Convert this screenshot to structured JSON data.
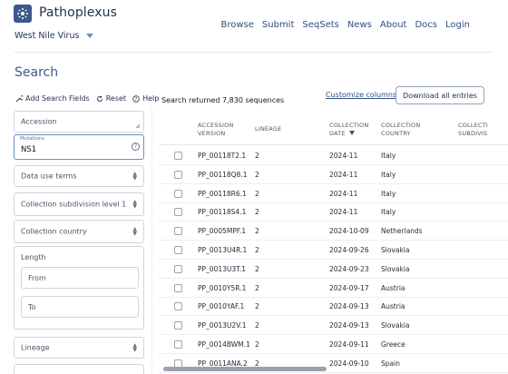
{
  "header": {
    "brand": "Pathoplexus",
    "organism": "West Nile Virus",
    "nav": [
      "Browse",
      "Submit",
      "SeqSets",
      "News",
      "About",
      "Docs",
      "Login"
    ]
  },
  "page": {
    "title": "Search"
  },
  "sidebar": {
    "tools": {
      "add_fields": "Add Search Fields",
      "reset": "Reset",
      "help": "Help"
    },
    "accession_label": "Accession",
    "mutations_label": "Mutations",
    "mutations_value": "NS1",
    "data_use_label": "Data use terms",
    "subdivision_label": "Collection subdivision level 1",
    "country_label": "Collection country",
    "length_label": "Length",
    "length_from": "From",
    "length_to": "To",
    "lineage_label": "Lineage"
  },
  "results": {
    "count_text": "Search returned 7,830 sequences",
    "customize_columns": "Customize columns",
    "download_all": "Download all entries",
    "columns": {
      "accession_l1": "ACCESSION",
      "accession_l2": "VERSION",
      "lineage": "LINEAGE",
      "date_l1": "COLLECTION",
      "date_l2": "DATE",
      "country_l1": "COLLECTION",
      "country_l2": "COUNTRY",
      "subdiv_l1": "COLLECTI",
      "subdiv_l2": "SUBDIVIS"
    },
    "rows": [
      {
        "accession": "PP_00118T2.1",
        "lineage": "2",
        "date": "2024-11",
        "country": "Italy"
      },
      {
        "accession": "PP_00118Q8.1",
        "lineage": "2",
        "date": "2024-11",
        "country": "Italy"
      },
      {
        "accession": "PP_00118R6.1",
        "lineage": "2",
        "date": "2024-11",
        "country": "Italy"
      },
      {
        "accession": "PP_00118S4.1",
        "lineage": "2",
        "date": "2024-11",
        "country": "Italy"
      },
      {
        "accession": "PP_0005MPF.1",
        "lineage": "2",
        "date": "2024-10-09",
        "country": "Netherlands"
      },
      {
        "accession": "PP_0013U4R.1",
        "lineage": "2",
        "date": "2024-09-26",
        "country": "Slovakia"
      },
      {
        "accession": "PP_0013U3T.1",
        "lineage": "2",
        "date": "2024-09-23",
        "country": "Slovakia"
      },
      {
        "accession": "PP_0010Y5R.1",
        "lineage": "2",
        "date": "2024-09-17",
        "country": "Austria"
      },
      {
        "accession": "PP_0010YAF.1",
        "lineage": "2",
        "date": "2024-09-13",
        "country": "Austria"
      },
      {
        "accession": "PP_0013U2V.1",
        "lineage": "2",
        "date": "2024-09-13",
        "country": "Slovakia"
      },
      {
        "accession": "PP_0014BWM.1",
        "lineage": "2",
        "date": "2024-09-11",
        "country": "Greece"
      },
      {
        "accession": "PP_0011ANA.2",
        "lineage": "2",
        "date": "2024-09-10",
        "country": "Spain"
      }
    ]
  }
}
